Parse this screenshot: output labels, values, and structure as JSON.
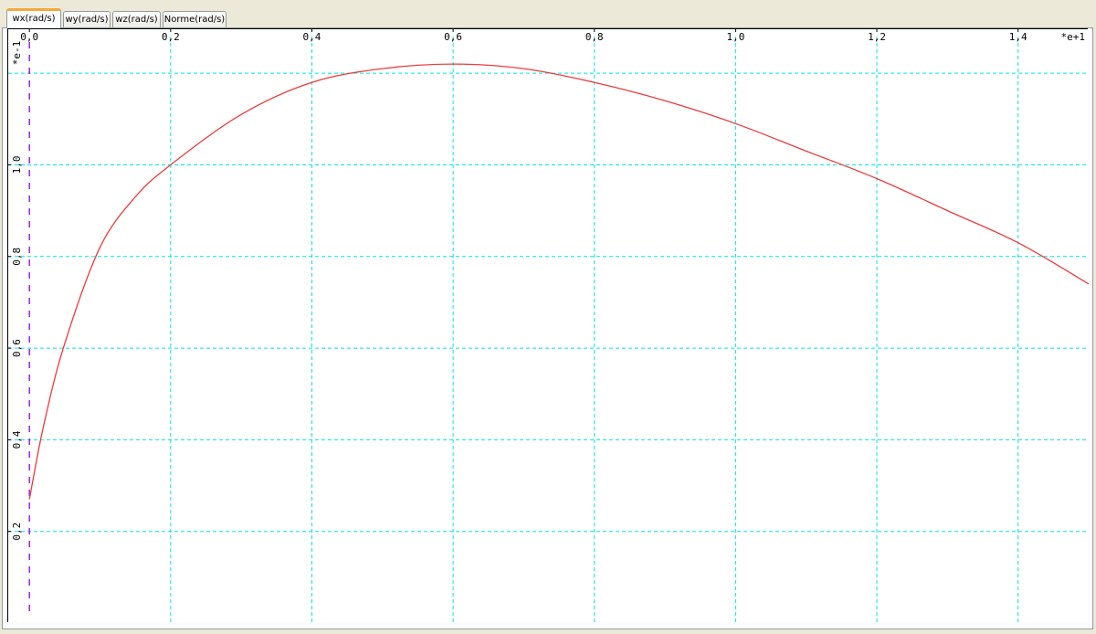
{
  "tabs": [
    {
      "label": "wx(rad/s)",
      "active": true
    },
    {
      "label": "wy(rad/s)",
      "active": false
    },
    {
      "label": "wz(rad/s)",
      "active": false
    },
    {
      "label": "Norme(rad/s)",
      "active": false
    }
  ],
  "chart_data": {
    "type": "line",
    "x_multiplier_label": "*e+1",
    "y_multiplier_label": "*e-1",
    "x_ticks": [
      "0,0",
      "0,2",
      "0,4",
      "0,6",
      "0,8",
      "1,0",
      "1,2",
      "1,4"
    ],
    "y_ticks": [
      "0,2",
      "0,4",
      "0,6",
      "0,8",
      "1,0"
    ],
    "xlim": [
      -0.03,
      1.5
    ],
    "ylim": [
      0.0,
      1.28
    ],
    "grid": true,
    "colors": {
      "series": "#ee3b3b",
      "grid": "#00e5ee",
      "cursor": "#a020f0"
    },
    "cursor_x": 0.0,
    "series": [
      {
        "x": [
          0.0,
          0.02,
          0.05,
          0.1,
          0.15,
          0.2,
          0.3,
          0.4,
          0.5,
          0.6,
          0.7,
          0.8,
          0.9,
          1.0,
          1.1,
          1.2,
          1.3,
          1.4,
          1.5
        ],
        "y": [
          0.27,
          0.43,
          0.61,
          0.82,
          0.93,
          1.0,
          1.11,
          1.18,
          1.21,
          1.22,
          1.21,
          1.18,
          1.14,
          1.09,
          1.03,
          0.97,
          0.9,
          0.83,
          0.74
        ]
      }
    ]
  }
}
